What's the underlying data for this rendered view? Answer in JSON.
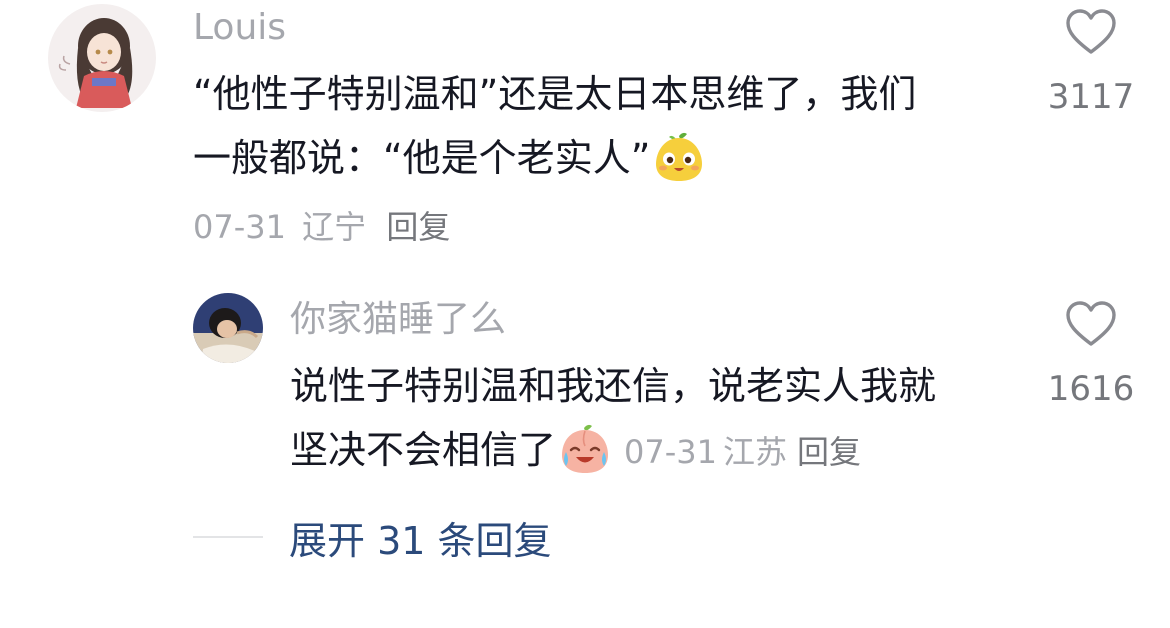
{
  "comment": {
    "username": "Louis",
    "text": "“他性子特别温和”还是太日本思维了，我们一般都说：“他是个老实人”",
    "text_line1": "“他性子特别温和”还是太日本思维了，我们",
    "text_line2": "一般都说：“他是个老实人”",
    "emoji": "yellow-fruit-smile-emoji",
    "date": "07-31",
    "location": "辽宁",
    "reply_label": "回复",
    "likes": "3117"
  },
  "reply": {
    "username": "你家猫睡了么",
    "text_line1": "说性子特别温和我还信，说老实人我就",
    "text_line2": "坚决不会相信了",
    "emoji": "peach-crying-laugh-emoji",
    "date": "07-31",
    "location": "江苏",
    "reply_label": "回复",
    "likes": "1616"
  },
  "expand": {
    "label": "展开 31 条回复"
  },
  "colors": {
    "text": "#161823",
    "muted": "#a5a7ad",
    "link": "#2b4a7b"
  }
}
